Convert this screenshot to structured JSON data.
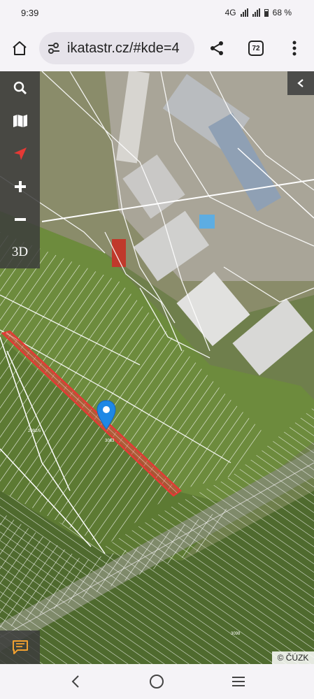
{
  "status_bar": {
    "time": "9:39",
    "network": "4G",
    "battery": "68 %"
  },
  "browser": {
    "url": "ikatastr.cz/#kde=4",
    "tab_count": "72"
  },
  "map": {
    "toolbar": {
      "three_d_label": "3D"
    },
    "attribution": "© ČÚZK",
    "accent_color": "#e53935",
    "marker_color": "#1e88e5"
  },
  "icons": [
    "home-icon",
    "site-settings-icon",
    "share-icon",
    "tabs-icon",
    "more-vert-icon",
    "search-icon",
    "map-icon",
    "locate-icon",
    "zoom-in-icon",
    "zoom-out-icon",
    "chevron-left-icon",
    "feedback-icon",
    "back-nav-icon",
    "home-nav-icon",
    "recents-nav-icon"
  ]
}
